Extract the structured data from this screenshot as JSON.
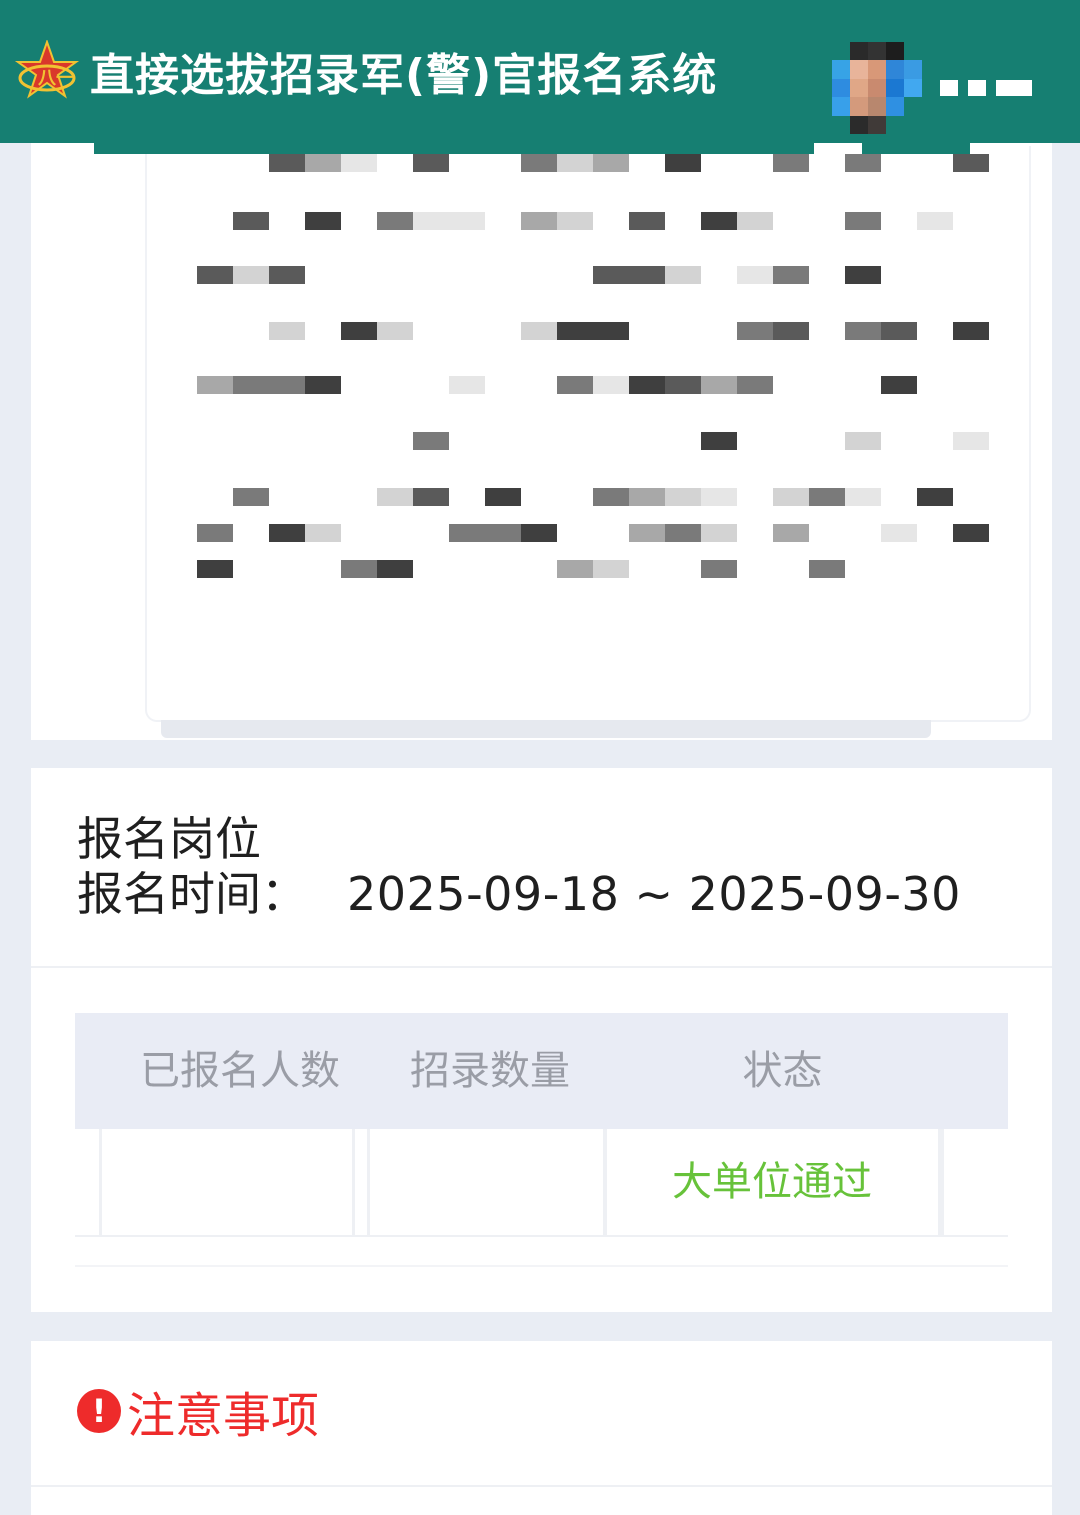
{
  "header": {
    "title": "直接选拔招录军(警)官报名系统",
    "icons": [
      "army-emblem-logo",
      "user-avatar"
    ],
    "bg_color": "#167f72"
  },
  "position": {
    "title": "报名岗位",
    "time_label": "报名时间：",
    "time_range": "2025-09-18 ~ 2025-09-30"
  },
  "table": {
    "headers": [
      "已报名人数",
      "招录数量",
      "状态"
    ],
    "rows": [
      {
        "registered": "",
        "quota": "",
        "status": "大单位通过"
      }
    ],
    "status_color": "#67c23a"
  },
  "notice": {
    "icon": "exclamation-circle-icon",
    "title": "注意事项",
    "color": "#ee2b2b"
  }
}
